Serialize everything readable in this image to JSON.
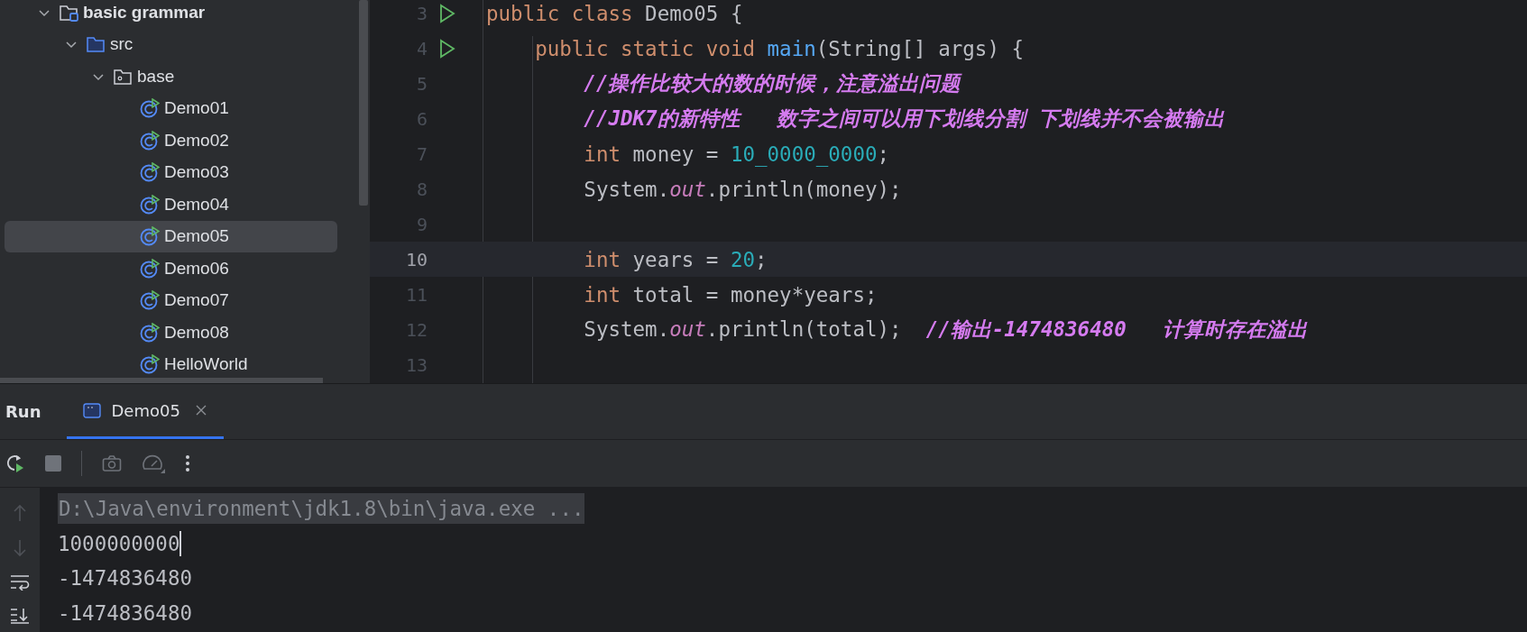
{
  "project_tree": {
    "items": [
      {
        "label": "basic grammar",
        "kind": "project",
        "expanded": true,
        "selected": false,
        "children": [
          {
            "label": "src",
            "kind": "source-folder",
            "expanded": true,
            "selected": false,
            "children": [
              {
                "label": "base",
                "kind": "package",
                "expanded": true,
                "selected": false,
                "children": [
                  {
                    "label": "Demo01",
                    "kind": "class",
                    "selected": false
                  },
                  {
                    "label": "Demo02",
                    "kind": "class",
                    "selected": false
                  },
                  {
                    "label": "Demo03",
                    "kind": "class",
                    "selected": false
                  },
                  {
                    "label": "Demo04",
                    "kind": "class",
                    "selected": false
                  },
                  {
                    "label": "Demo05",
                    "kind": "class",
                    "selected": true
                  },
                  {
                    "label": "Demo06",
                    "kind": "class",
                    "selected": false
                  },
                  {
                    "label": "Demo07",
                    "kind": "class",
                    "selected": false
                  },
                  {
                    "label": "Demo08",
                    "kind": "class",
                    "selected": false
                  },
                  {
                    "label": "HelloWorld",
                    "kind": "class",
                    "selected": false
                  }
                ]
              }
            ]
          }
        ]
      }
    ]
  },
  "editor": {
    "lines": [
      {
        "number": "3",
        "run_icon": true,
        "current": false,
        "tokens": [
          {
            "kind": "keyword",
            "text": "public class "
          },
          {
            "kind": "plain",
            "text": "Demo05 {"
          }
        ]
      },
      {
        "number": "4",
        "run_icon": true,
        "current": false,
        "tokens": [
          {
            "kind": "keyword",
            "text": "    public static void "
          },
          {
            "kind": "function",
            "text": "main"
          },
          {
            "kind": "plain",
            "text": "(String[] args) {"
          }
        ]
      },
      {
        "number": "5",
        "current": false,
        "tokens": [
          {
            "kind": "comment",
            "text": "        //操作比较大的数的时候，注意溢出问题"
          }
        ]
      },
      {
        "number": "6",
        "current": false,
        "tokens": [
          {
            "kind": "comment",
            "text": "        //JDK7的新特性   数字之间可以用下划线分割 下划线并不会被输出"
          }
        ]
      },
      {
        "number": "7",
        "current": false,
        "tokens": [
          {
            "kind": "keyword",
            "text": "        int "
          },
          {
            "kind": "plain",
            "text": "money = "
          },
          {
            "kind": "number",
            "text": "10_0000_0000"
          },
          {
            "kind": "plain",
            "text": ";"
          }
        ]
      },
      {
        "number": "8",
        "current": false,
        "tokens": [
          {
            "kind": "plain",
            "text": "        System."
          },
          {
            "kind": "field",
            "text": "out"
          },
          {
            "kind": "plain",
            "text": ".println(money);"
          }
        ]
      },
      {
        "number": "9",
        "current": false
      },
      {
        "number": "10",
        "current": true,
        "tokens": [
          {
            "kind": "keyword",
            "text": "        int "
          },
          {
            "kind": "plain",
            "text": "years = "
          },
          {
            "kind": "number",
            "text": "20"
          },
          {
            "kind": "plain",
            "text": ";"
          }
        ]
      },
      {
        "number": "11",
        "current": false,
        "tokens": [
          {
            "kind": "keyword",
            "text": "        int "
          },
          {
            "kind": "plain",
            "text": "total = money*years;"
          }
        ]
      },
      {
        "number": "12",
        "current": false,
        "tokens": [
          {
            "kind": "plain",
            "text": "        System."
          },
          {
            "kind": "field",
            "text": "out"
          },
          {
            "kind": "plain",
            "text": ".println(total);  "
          },
          {
            "kind": "comment",
            "text": "//输出-1474836480   计算时存在溢出"
          }
        ]
      },
      {
        "number": "13",
        "current": false
      }
    ]
  },
  "run_panel": {
    "title": "Run",
    "tabs": [
      {
        "label": "Demo05",
        "selected": true,
        "closable": true
      }
    ],
    "console": [
      {
        "kind": "command",
        "text": "D:\\Java\\environment\\jdk1.8\\bin\\java.exe ...",
        "caret": false
      },
      {
        "kind": "output",
        "text": "1000000000",
        "caret": true
      },
      {
        "kind": "output",
        "text": "-1474836480",
        "caret": false
      },
      {
        "kind": "output",
        "text": "-1474836480",
        "caret": false
      }
    ]
  }
}
